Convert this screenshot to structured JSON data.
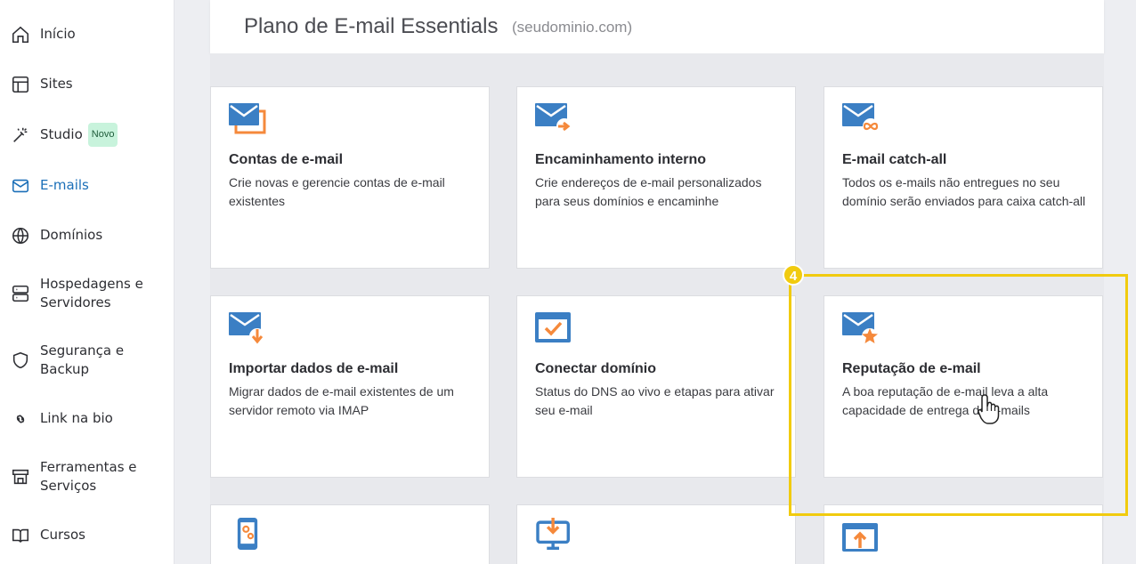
{
  "sidebar": {
    "items": [
      {
        "label": "Início",
        "icon": "home-icon"
      },
      {
        "label": "Sites",
        "icon": "layout-icon"
      },
      {
        "label": "Studio",
        "icon": "magic-wand-icon",
        "badge": "Novo"
      },
      {
        "label": "E-mails",
        "icon": "mail-icon",
        "active": true
      },
      {
        "label": "Domínios",
        "icon": "globe-icon"
      },
      {
        "label": "Hospedagens e",
        "label2": "Servidores",
        "icon": "server-icon"
      },
      {
        "label": "Segurança e",
        "label2": "Backup",
        "icon": "shield-icon"
      },
      {
        "label": "Link na bio",
        "icon": "link-icon"
      },
      {
        "label": "Ferramentas e",
        "label2": "Serviços",
        "icon": "store-icon"
      },
      {
        "label": "Cursos",
        "icon": "book-icon"
      }
    ]
  },
  "header": {
    "title": "Plano de E-mail Essentials",
    "domain": "(seudominio.com)"
  },
  "cards": [
    {
      "title": "Contas de e-mail",
      "desc": "Crie novas e gerencie contas de e-mail existentes",
      "icon": "mail-accounts-icon"
    },
    {
      "title": "Encaminhamento interno",
      "desc": "Crie endereços de e-mail personalizados para seus domínios e encaminhe",
      "icon": "mail-forward-icon"
    },
    {
      "title": "E-mail catch-all",
      "desc": "Todos os e-mails não entregues no seu domínio serão enviados para caixa catch-all",
      "icon": "mail-infinity-icon"
    },
    {
      "title": "Importar dados de e-mail",
      "desc": "Migrar dados de e-mail existentes de um servidor remoto via IMAP",
      "icon": "mail-import-icon"
    },
    {
      "title": "Conectar domínio",
      "desc": "Status do DNS ao vivo e etapas para ativar seu e-mail",
      "icon": "browser-check-icon"
    },
    {
      "title": "Reputação de e-mail",
      "desc": "A boa reputação de e-mail leva a alta capacidade de entrega de e-mails",
      "icon": "mail-star-icon"
    },
    {
      "title": "",
      "desc": "",
      "icon": "mobile-settings-icon"
    },
    {
      "title": "",
      "desc": "",
      "icon": "monitor-download-icon"
    },
    {
      "title": "",
      "desc": "",
      "icon": "browser-upload-icon"
    }
  ],
  "annotation": {
    "step": "4"
  },
  "colors": {
    "accent": "#1b6fb8",
    "icon_blue": "#3b7fc4",
    "icon_orange": "#f5893b",
    "highlight": "#f1cb0f"
  }
}
